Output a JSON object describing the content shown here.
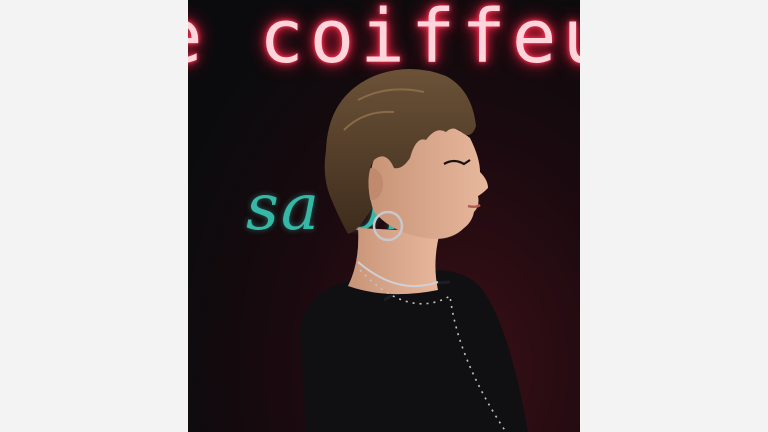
{
  "photo": {
    "neon_sign_text": "e coiffeu",
    "script_sign_text": "sa on",
    "colors": {
      "page_background": "#f3f3f3",
      "backdrop": "#0b0b0d",
      "neon_pink": "#ff2748",
      "script_teal": "#37b8a6"
    }
  }
}
